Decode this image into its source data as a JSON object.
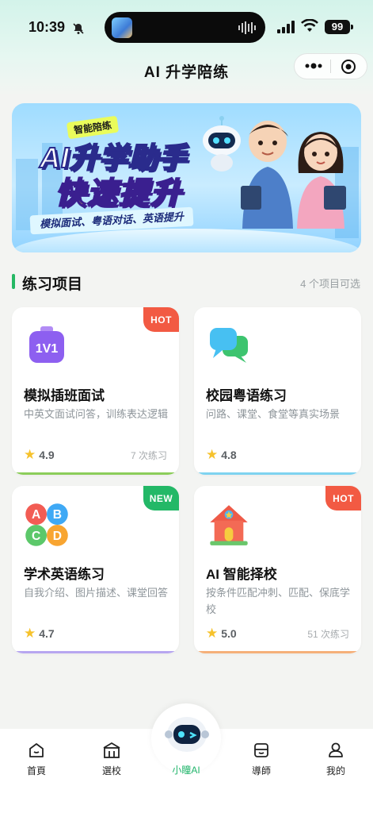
{
  "status_bar": {
    "time": "10:39",
    "battery": "99"
  },
  "header": {
    "title": "AI 升学陪练"
  },
  "banner": {
    "badge": "智能陪练",
    "line1": "AI升学助手",
    "line2": "快速提升",
    "ribbon": "模拟面试、粤语对话、英语提升"
  },
  "section": {
    "title": "练习项目",
    "meta": "4 个项目可选"
  },
  "cards": [
    {
      "title": "模拟插班面试",
      "desc": "中英文面试问答，训练表达逻辑",
      "rating": "4.9",
      "count": "7 次练习",
      "tag": "HOT",
      "tag_color": "#f25a43",
      "stripe": "#8ccd5a"
    },
    {
      "title": "校园粤语练习",
      "desc": "问路、课堂、食堂等真实场景",
      "rating": "4.8",
      "count": "",
      "tag": "",
      "tag_color": "",
      "stripe": "#7fd3f0"
    },
    {
      "title": "学术英语练习",
      "desc": "自我介绍、图片描述、课堂回答",
      "rating": "4.7",
      "count": "",
      "tag": "NEW",
      "tag_color": "#23b867",
      "stripe": "#b7a6f0"
    },
    {
      "title": "AI 智能择校",
      "desc": "按条件匹配冲刺、匹配、保底学校",
      "rating": "5.0",
      "count": "51 次练习",
      "tag": "HOT",
      "tag_color": "#f25a43",
      "stripe": "#f5b07a"
    }
  ],
  "tabs": {
    "home": "首頁",
    "school": "選校",
    "ai": "小瞳AI",
    "tutor": "導師",
    "mine": "我的"
  },
  "colors": {
    "accent": "#25b864",
    "hot": "#f25a43",
    "new": "#23b867"
  }
}
